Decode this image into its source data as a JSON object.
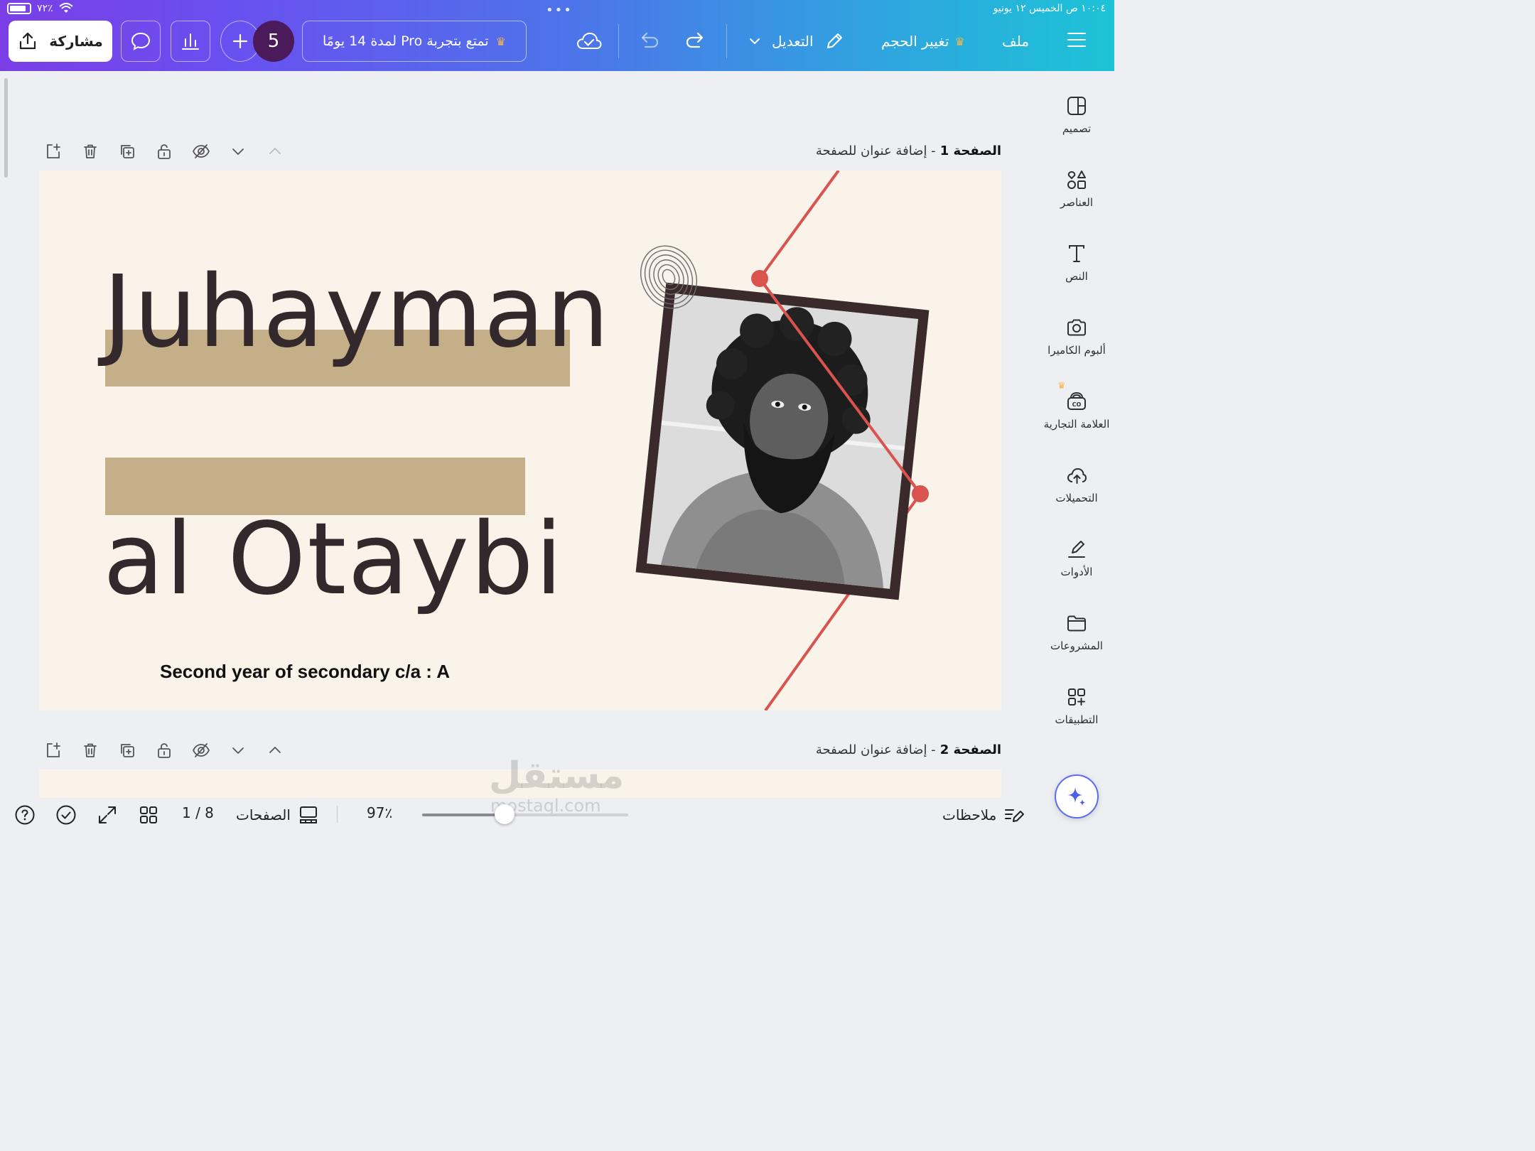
{
  "status_bar": {
    "battery": "٧٢٪",
    "time_date": "١٠:٠٤ ص   الخميس ١٢ يونيو"
  },
  "toolbar": {
    "share_label": "مشاركة",
    "collaborator_count": "5",
    "pro_trial_label": "تمتع بتجربة Pro لمدة 14 يومًا",
    "edit_label": "التعديل",
    "resize_label": "تغيير الحجم",
    "file_label": "ملف"
  },
  "sidebar": {
    "items": [
      {
        "label": "تصميم",
        "icon": "layout-icon"
      },
      {
        "label": "العناصر",
        "icon": "shapes-icon"
      },
      {
        "label": "النص",
        "icon": "text-icon"
      },
      {
        "label": "ألبوم الكاميرا",
        "icon": "camera-icon"
      },
      {
        "label": "العلامة التجارية",
        "icon": "brand-icon"
      },
      {
        "label": "التحميلات",
        "icon": "upload-cloud-icon"
      },
      {
        "label": "الأدوات",
        "icon": "draw-tool-icon"
      },
      {
        "label": "المشروعات",
        "icon": "folder-icon"
      },
      {
        "label": "التطبيقات",
        "icon": "apps-icon"
      }
    ]
  },
  "pages": [
    {
      "number": "الصفحة 1",
      "title_placeholder": "- إضافة عنوان للصفحة"
    },
    {
      "number": "الصفحة 2",
      "title_placeholder": "- إضافة عنوان للصفحة"
    }
  ],
  "slide": {
    "title_line1": "Juhayman",
    "title_line2": "al Otaybi",
    "subtitle": "Second year of secondary c/a : A",
    "highlight_color": "#c4af88",
    "background_color": "#faf3ea",
    "accent_line_color": "#d9534f",
    "text_color": "#33282b"
  },
  "bottom_bar": {
    "notes_label": "ملاحظات",
    "zoom": "97٪",
    "zoom_level": 0.4,
    "pages_label": "الصفحات",
    "page_indicator": "1 / 8"
  },
  "watermark": {
    "text": "مستقل",
    "url": "mostaql.com"
  }
}
